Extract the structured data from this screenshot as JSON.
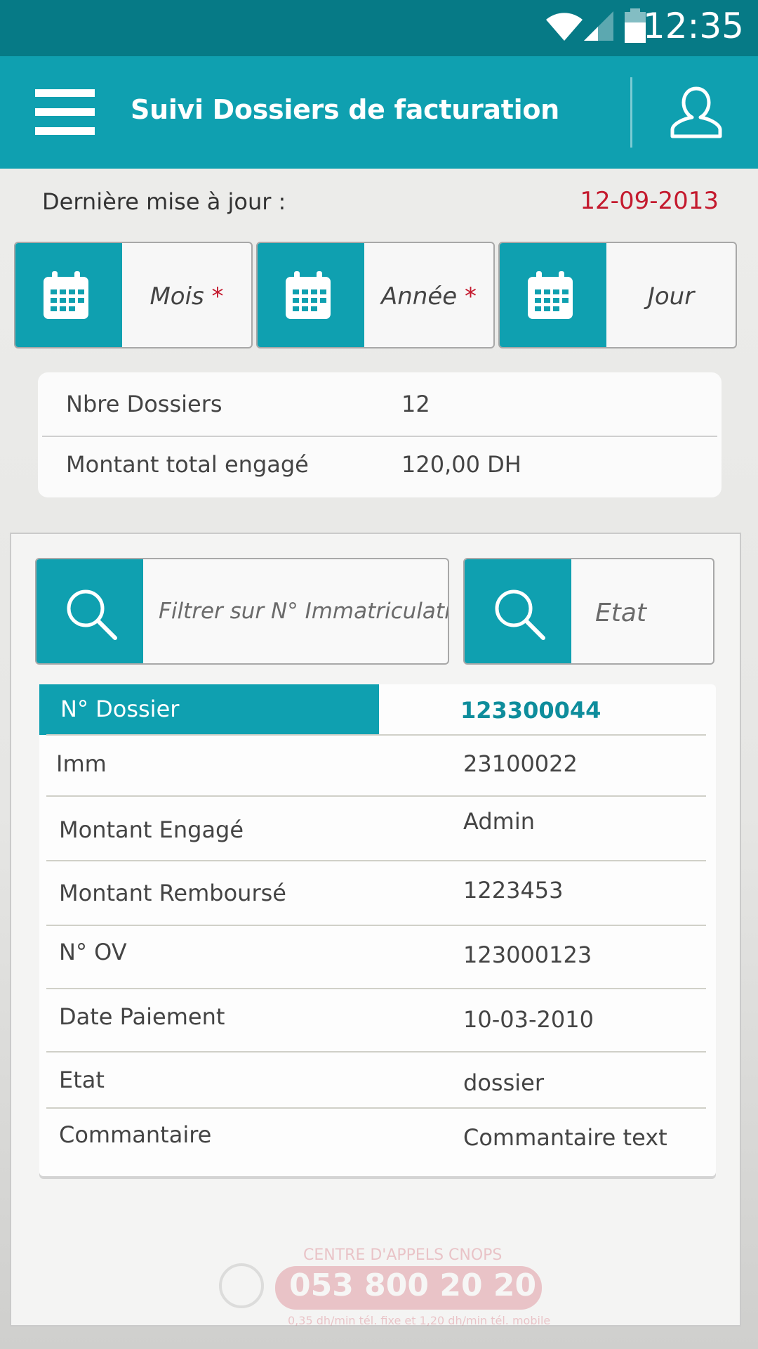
{
  "status_bar": {
    "time": "12:35",
    "icons": [
      "wifi-icon",
      "signal-icon",
      "battery-icon"
    ]
  },
  "app_bar": {
    "title": "Suivi Dossiers de facturation",
    "menu_icon": "hamburger-menu-icon",
    "user_icon": "user-profile-icon",
    "color": "#0fa0b0"
  },
  "last_update": {
    "label": "Dernière mise à jour :",
    "date": "12-09-2013",
    "date_color": "#c41a2e"
  },
  "pickers": [
    {
      "label": "Mois",
      "required": "*",
      "icon": "calendar-icon"
    },
    {
      "label": "Année",
      "required": "*",
      "icon": "calendar-icon"
    },
    {
      "label": "Jour",
      "required": "",
      "icon": "calendar-icon"
    }
  ],
  "summary": [
    {
      "label": "Nbre Dossiers",
      "value": "12"
    },
    {
      "label": "Montant total engagé",
      "value": "120,00 DH"
    }
  ],
  "filters": {
    "immatriculation_placeholder": "Filtrer sur N° Immatriculation",
    "etat_placeholder": "Etat",
    "icon": "search-icon"
  },
  "dossier": {
    "header_label": "N° Dossier",
    "header_value": "123300044",
    "rows": [
      {
        "label": "Imm",
        "value": "23100022"
      },
      {
        "label": "Montant Engagé",
        "value": "Admin"
      },
      {
        "label": "Montant Remboursé",
        "value": "1223453"
      },
      {
        "label": "N° OV",
        "value": "123000123"
      },
      {
        "label": "Date Paiement",
        "value": "10-03-2010"
      },
      {
        "label": "Etat",
        "value": "dossier"
      },
      {
        "label": "Commantaire",
        "value": "Commantaire text"
      }
    ]
  },
  "footer": {
    "title": "CENTRE D'APPELS CNOPS",
    "phone": "053 800 20 20",
    "note": "0,35 dh/min tél. fixe et 1,20 dh/min tél. mobile"
  }
}
